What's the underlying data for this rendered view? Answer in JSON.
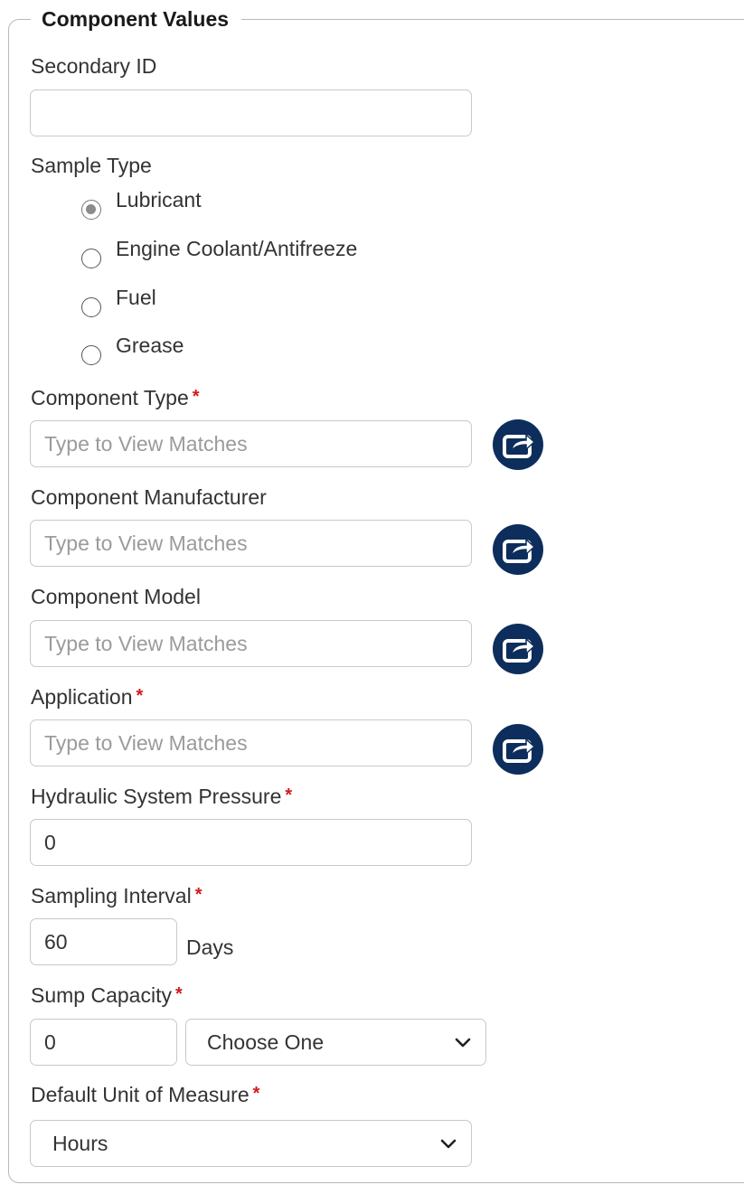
{
  "legend": "Component Values",
  "secondary_id": {
    "label": "Secondary ID",
    "value": "",
    "placeholder": ""
  },
  "sample_type": {
    "label": "Sample Type",
    "options": [
      {
        "label": "Lubricant",
        "checked": true
      },
      {
        "label": "Engine Coolant/Antifreeze",
        "checked": false
      },
      {
        "label": "Fuel",
        "checked": false
      },
      {
        "label": "Grease",
        "checked": false
      }
    ]
  },
  "component_type": {
    "label": "Component Type",
    "required_mark": "*",
    "placeholder": "Type to View Matches"
  },
  "component_manufacturer": {
    "label": "Component Manufacturer",
    "placeholder": "Type to View Matches"
  },
  "component_model": {
    "label": "Component Model",
    "placeholder": "Type to View Matches"
  },
  "application": {
    "label": "Application",
    "required_mark": "*",
    "placeholder": "Type to View Matches"
  },
  "hydraulic_pressure": {
    "label": "Hydraulic System Pressure",
    "required_mark": "*",
    "value": "0"
  },
  "sampling_interval": {
    "label": "Sampling Interval",
    "required_mark": "*",
    "value": "60",
    "unit": "Days"
  },
  "sump_capacity": {
    "label": "Sump Capacity",
    "required_mark": "*",
    "value": "0",
    "unit_select": "Choose One"
  },
  "default_uom": {
    "label": "Default Unit of Measure",
    "required_mark": "*",
    "selected": "Hours"
  },
  "icons": {
    "lookup": "external-link-icon",
    "dropdown": "chevron-down-icon"
  },
  "colors": {
    "required": "#d11a1a",
    "lookup_button": "#0d2e5c",
    "border": "#c9c9c9"
  }
}
